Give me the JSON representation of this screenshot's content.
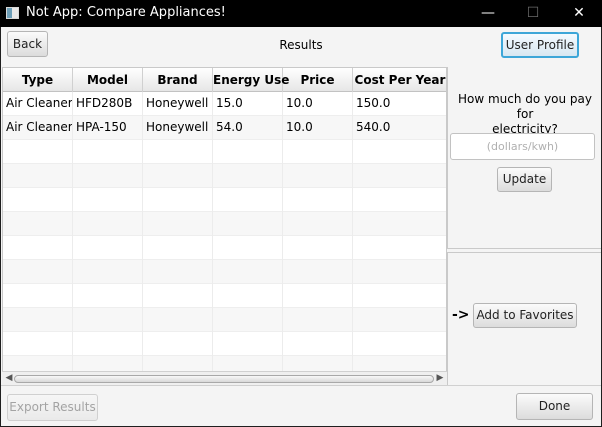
{
  "window": {
    "title": "Not App: Compare Appliances!",
    "minimize_glyph": "—",
    "maximize_glyph": "☐",
    "close_glyph": "✕"
  },
  "header": {
    "back_label": "Back",
    "page_title": "Results",
    "user_profile_label": "User Profile"
  },
  "table": {
    "columns": [
      "Type",
      "Model",
      "Brand",
      "Energy Use",
      "Price",
      "Cost Per Year"
    ],
    "rows": [
      [
        "Air Cleaner",
        "HFD280B",
        "Honeywell",
        "15.0",
        "10.0",
        "150.0"
      ],
      [
        "Air Cleaner",
        "HPA-150",
        "Honeywell",
        "54.0",
        "10.0",
        "540.0"
      ]
    ],
    "scroll_left_glyph": "◀",
    "scroll_right_glyph": "▶"
  },
  "side_panel": {
    "question_line1": "How much do you pay for",
    "question_line2": "electricity?",
    "rate_value": "",
    "rate_placeholder": "(dollars/kwh)",
    "update_label": "Update",
    "arrow_hint": "->",
    "add_favorites_label": "Add to Favorites"
  },
  "footer": {
    "export_label": "Export Results",
    "done_label": "Done"
  }
}
